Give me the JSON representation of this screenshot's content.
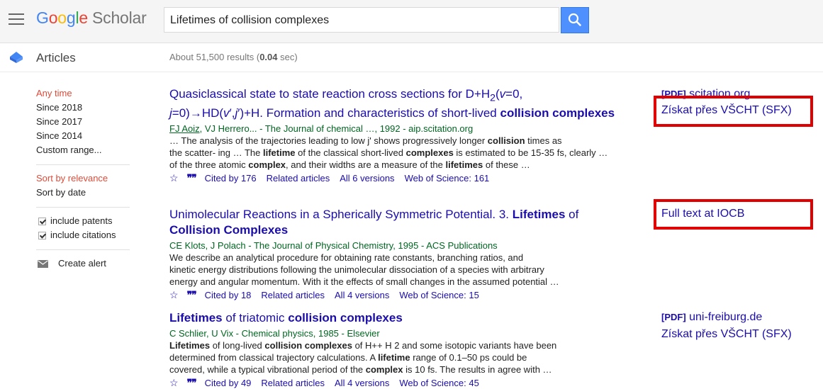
{
  "header": {
    "logo_google": [
      "G",
      "o",
      "o",
      "g",
      "l",
      "e"
    ],
    "logo_scholar": "Scholar",
    "search_value": "Lifetimes of collision complexes"
  },
  "subheader": {
    "section": "Articles",
    "results_prefix": "About 51,500 results (",
    "results_time": "0.04",
    "results_suffix": " sec)"
  },
  "sidebar": {
    "time_filters": [
      "Any time",
      "Since 2018",
      "Since 2017",
      "Since 2014",
      "Custom range..."
    ],
    "sort_options": [
      "Sort by relevance",
      "Sort by date"
    ],
    "checkboxes": [
      "include patents",
      "include citations"
    ],
    "create_alert": "Create alert"
  },
  "results": [
    {
      "title_html": "Quasiclassical state to state reaction cross sections for D+H<sub>2</sub>(<i>v</i>=0,<br><i>j</i>=0)→HD(<i>v</i>′,<i>j</i>′)+H. Formation and characteristics of short-lived <b>collision complexes</b>",
      "author_link": "FJ Aoiz",
      "authors_rest": ", VJ Herrero... - The Journal of chemical …, 1992 - aip.scitation.org",
      "snippet_html": [
        "… The analysis of the trajectories leading to low j' shows progressively longer <b>collision</b> times as",
        "the scatter- ing … The <b>lifetime</b> of the classical short-lived <b>complexes</b> is estimated to be 15-35 fs, clearly …",
        "of the three atomic <b>complex</b>, and their widths are a measure of the <b>lifetimes</b> of these …"
      ],
      "actions": [
        "Cited by 176",
        "Related articles",
        "All 6 versions",
        "Web of Science: 161"
      ],
      "side_tag": "[PDF]",
      "side_source": " scitation.org",
      "side_link2": "Získat přes VŠCHT (SFX)"
    },
    {
      "title_html": "Unimolecular Reactions in a Spherically Symmetric Potential. 3. <b>Lifetimes</b> of<br><b>Collision Complexes</b>",
      "author_link": "",
      "authors_rest": "CE Klots, J Polach - The Journal of Physical Chemistry, 1995 - ACS Publications",
      "snippet_html": [
        "We describe an analytical procedure for obtaining rate constants, branching ratios, and",
        "kinetic energy distributions following the unimolecular dissociation of a species with arbitrary",
        "energy and angular momentum. With it the effects of small changes in the assumed potential …"
      ],
      "actions": [
        "Cited by 18",
        "Related articles",
        "All 4 versions",
        "Web of Science: 15"
      ],
      "side_link": "Full text at IOCB"
    },
    {
      "title_html": "<b>Lifetimes</b> of triatomic <b>collision complexes</b>",
      "author_link": "",
      "authors_rest": "C Schlier, U Vix - Chemical physics, 1985 - Elsevier",
      "snippet_html": [
        "<b>Lifetimes</b> of long-lived <b>collision complexes</b> of H++ H 2 and some isotopic variants have been",
        "determined from classical trajectory calculations. A <b>lifetime</b> range of 0.1–50 ps could be",
        "covered, while a typical vibrational period of the <b>complex</b> is 10 fs. The results in agree with …"
      ],
      "actions": [
        "Cited by 49",
        "Related articles",
        "All 4 versions",
        "Web of Science: 45"
      ],
      "side_tag": "[PDF]",
      "side_source": " uni-freiburg.de",
      "side_link2": "Získat přes VŠCHT (SFX)"
    }
  ],
  "colors": {
    "link": "#1a0dab",
    "green": "#006621",
    "active": "#dd4b39",
    "highlight": "#e00000"
  }
}
